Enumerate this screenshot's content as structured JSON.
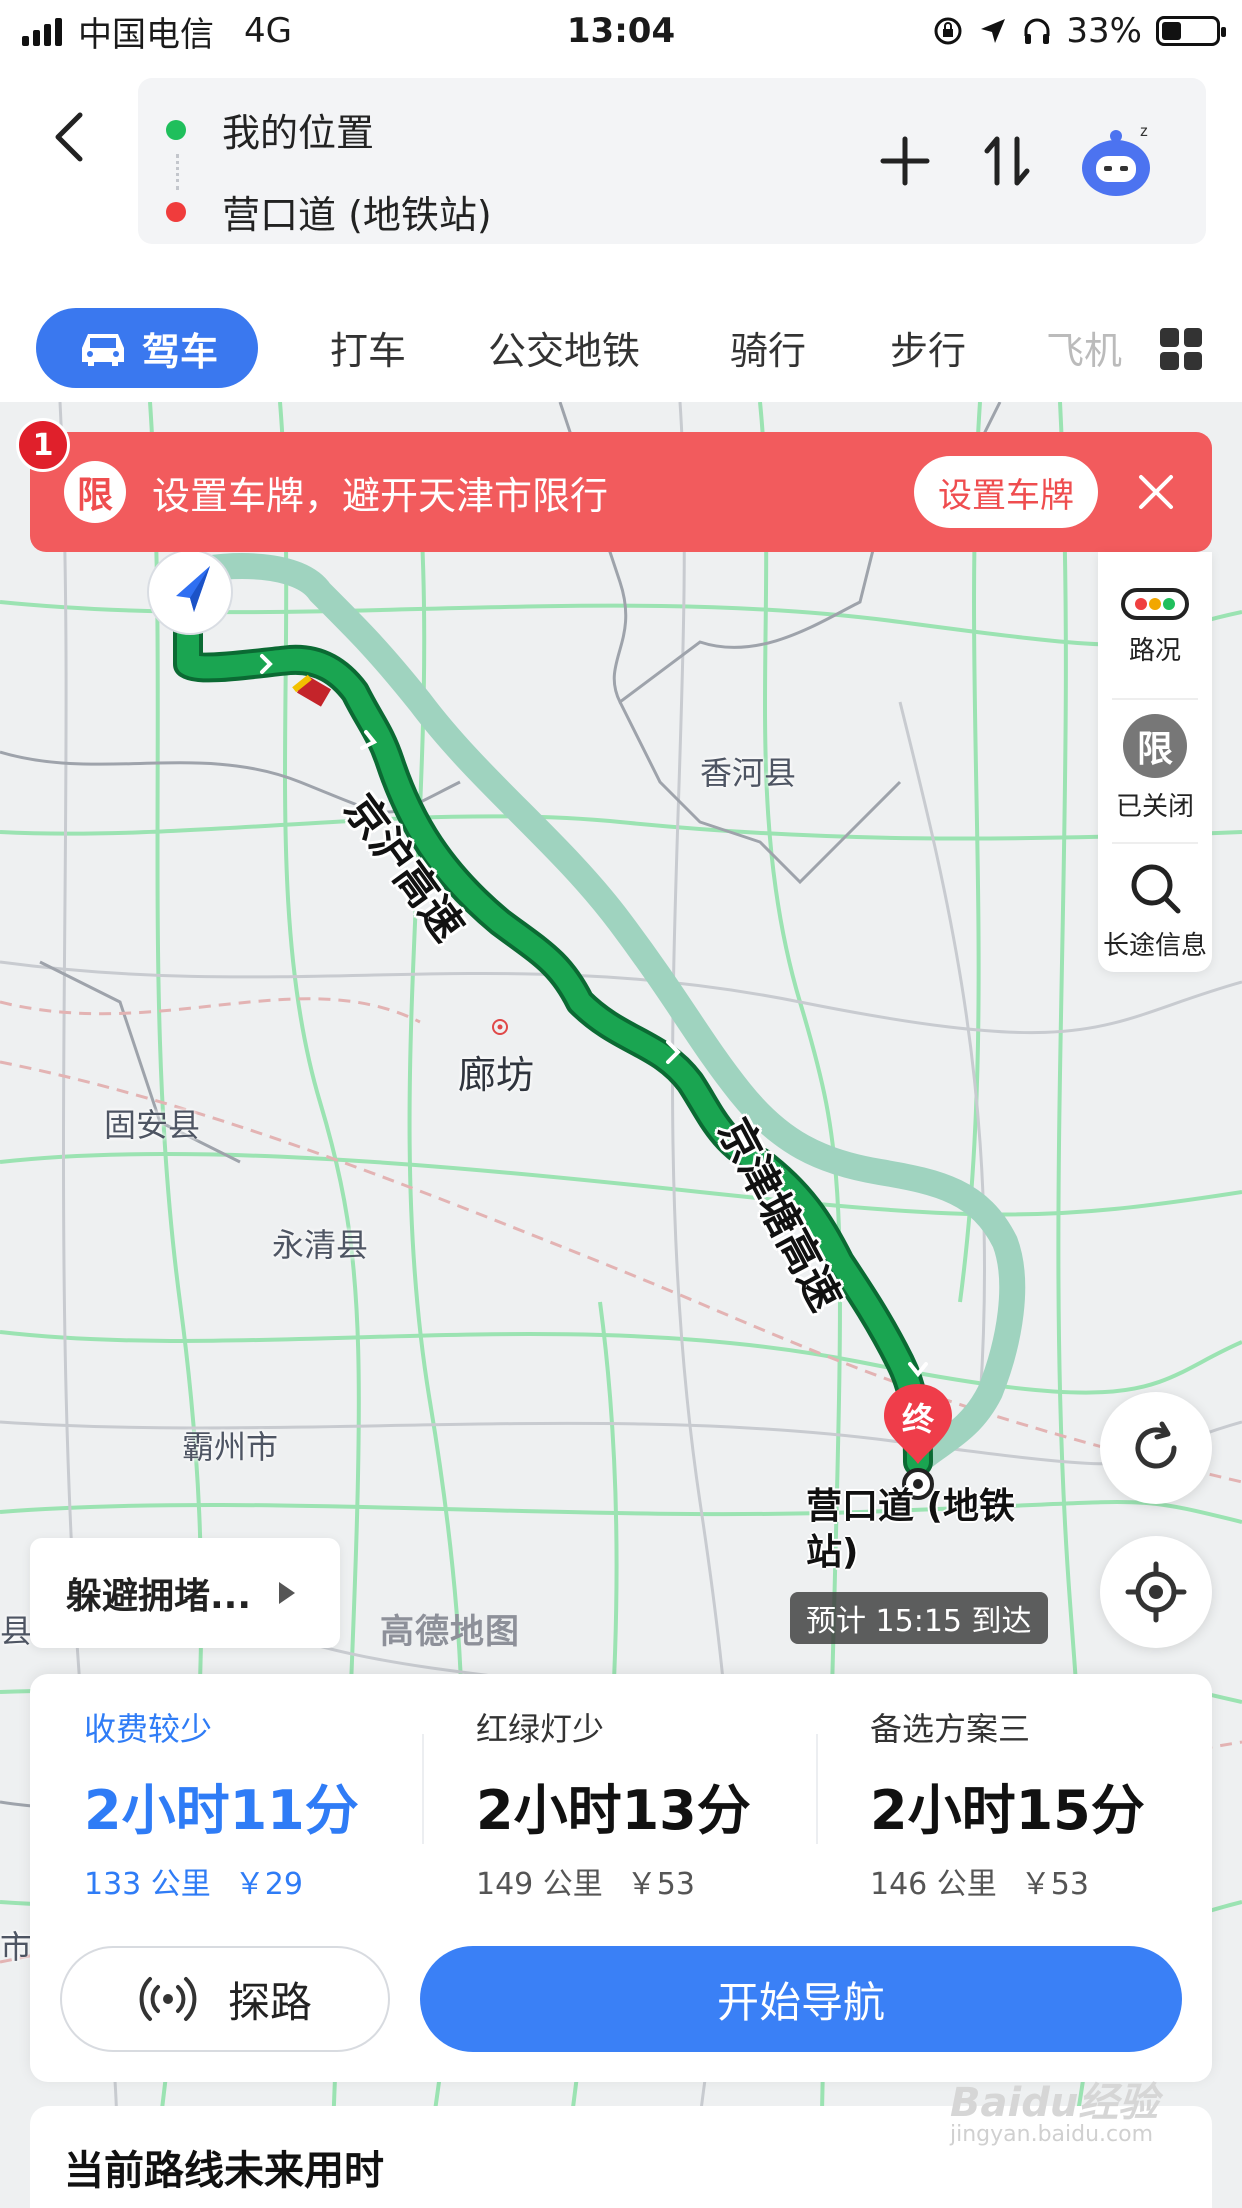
{
  "status_bar": {
    "carrier": "中国电信",
    "network": "4G",
    "time": "13:04",
    "battery": "33%",
    "icons": [
      "signal-icon",
      "rotation-lock-icon",
      "location-arrow-icon",
      "headphones-icon",
      "battery-icon"
    ]
  },
  "route_input": {
    "origin": "我的位置",
    "destination": "营口道 (地铁站)",
    "origin_color": "#1fbf5c",
    "destination_color": "#f03c3c"
  },
  "tabs": {
    "active": "驾车",
    "items": [
      "打车",
      "公交地铁",
      "骑行",
      "步行",
      "飞机"
    ]
  },
  "banner": {
    "badge": "1",
    "icon_text": "限",
    "message": "设置车牌，避开天津市限行",
    "button": "设置车牌"
  },
  "side_panel": {
    "traffic": "路况",
    "limit_icon": "限",
    "limit": "已关闭",
    "longtrip": "长途信息"
  },
  "map": {
    "labels": {
      "xianghe": "香河县",
      "langfang": "廊坊",
      "guan": "固安县",
      "yongqing": "永清县",
      "bazhou": "霸州市",
      "edge_county": "县",
      "edge_city": "市"
    },
    "roads": {
      "jinghu": "京沪高速",
      "jingjintang": "京津塘高速"
    },
    "destination_marker": "终",
    "destination_label": "营口道 (地铁站)",
    "eta": "预计 15:15 到达",
    "watermark": "高德地图",
    "avoid": "躲避拥堵...",
    "colors": {
      "route_main": "#1aa551",
      "route_alt": "#9fd3bf"
    }
  },
  "routes": [
    {
      "tag": "收费较少",
      "duration": "2小时11分",
      "distance": "133 公里",
      "toll": "￥29"
    },
    {
      "tag": "红绿灯少",
      "duration": "2小时13分",
      "distance": "149 公里",
      "toll": "￥53"
    },
    {
      "tag": "备选方案三",
      "duration": "2小时15分",
      "distance": "146 公里",
      "toll": "￥53"
    }
  ],
  "actions": {
    "probe": "探路",
    "navigate": "开始导航"
  },
  "future": {
    "title": "当前路线未来用时"
  },
  "watermark_baidu": {
    "brand": "Baidu经验",
    "url": "jingyan.baidu.com"
  }
}
